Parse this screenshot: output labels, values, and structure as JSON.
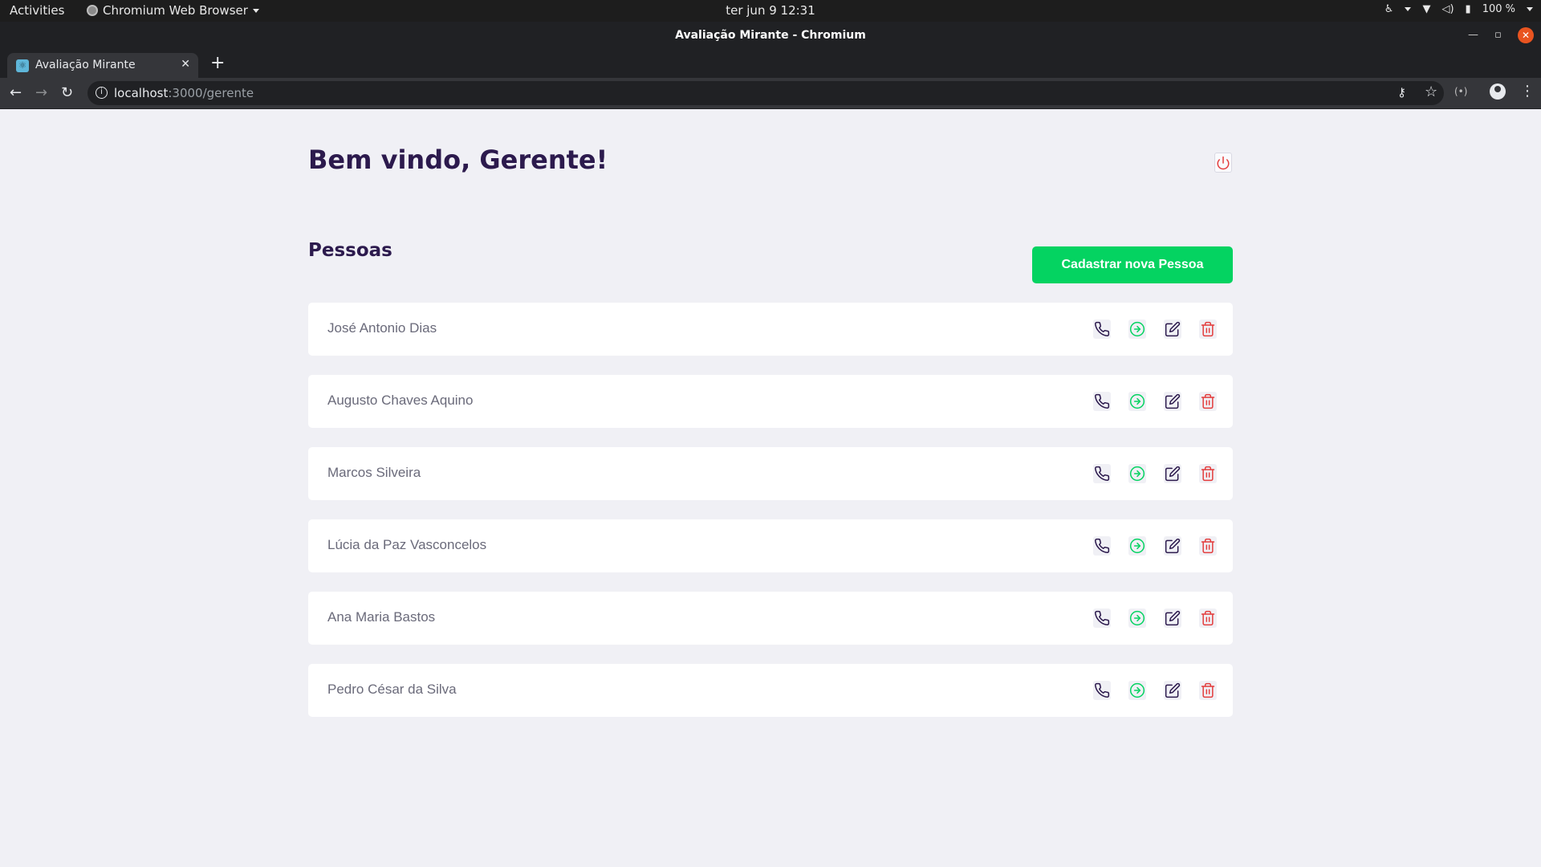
{
  "system_bar": {
    "activities": "Activities",
    "app_name": "Chromium Web Browser",
    "clock": "ter jun 9  12:31",
    "battery": "100 %"
  },
  "window": {
    "title": "Avaliação Mirante - Chromium"
  },
  "tabs": [
    {
      "title": "Avaliação Mirante"
    }
  ],
  "address_bar": {
    "host": "localhost",
    "path": ":3000/gerente"
  },
  "page": {
    "welcome": "Bem vindo, Gerente!",
    "section_title": "Pessoas",
    "register_button": "Cadastrar nova Pessoa",
    "people": [
      {
        "name": "José Antonio Dias"
      },
      {
        "name": "Augusto Chaves Aquino"
      },
      {
        "name": "Marcos Silveira"
      },
      {
        "name": "Lúcia da Paz Vasconcelos"
      },
      {
        "name": "Ana Maria Bastos"
      },
      {
        "name": "Pedro César da Silva"
      }
    ],
    "row_actions": [
      {
        "icon": "phone-icon",
        "color": "#2c1a4d"
      },
      {
        "icon": "arrow-right-circle-icon",
        "color": "#04d361"
      },
      {
        "icon": "edit-icon",
        "color": "#2c1a4d"
      },
      {
        "icon": "trash-icon",
        "color": "#e33d3d"
      }
    ]
  },
  "colors": {
    "accent": "#04d361",
    "title": "#2c1a4d",
    "danger": "#e33d3d",
    "page_bg": "#f0f0f5"
  }
}
